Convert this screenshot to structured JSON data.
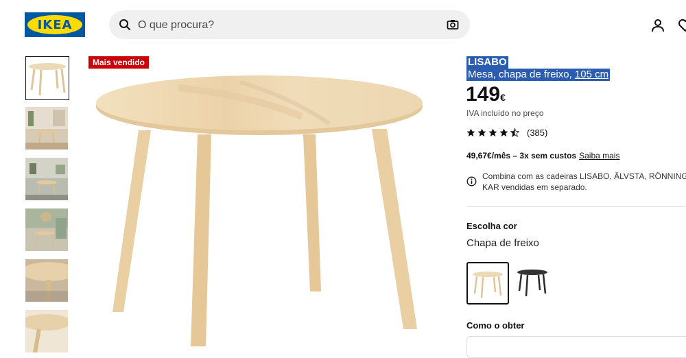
{
  "header": {
    "logo_text": "IKEA",
    "search_placeholder": "O que procura?"
  },
  "colors": {
    "brand_blue": "#0058a3",
    "brand_yellow": "#ffdb00",
    "badge_red": "#cc0008",
    "selection_blue": "#2a5db0"
  },
  "badge": "Mais vendido",
  "product": {
    "name": "LISABO",
    "desc_prefix": "Mesa, chapa de freixo, ",
    "desc_size": "105 cm",
    "price": "149",
    "currency": "€",
    "vat": "IVA incluído no preço",
    "rating": 4.5,
    "reviews": "(385)",
    "financing_text": "49,67€/mês – 3x sem custos",
    "financing_link": "Saiba mais",
    "combo_text": "Combina com as cadeiras LISABO, ÄLVSTA, RÖNNINGE e KAR vendidas em separado.",
    "choose_color_label": "Escolha cor",
    "color_name": "Chapa de freixo",
    "obtain_label": "Como o obter"
  }
}
